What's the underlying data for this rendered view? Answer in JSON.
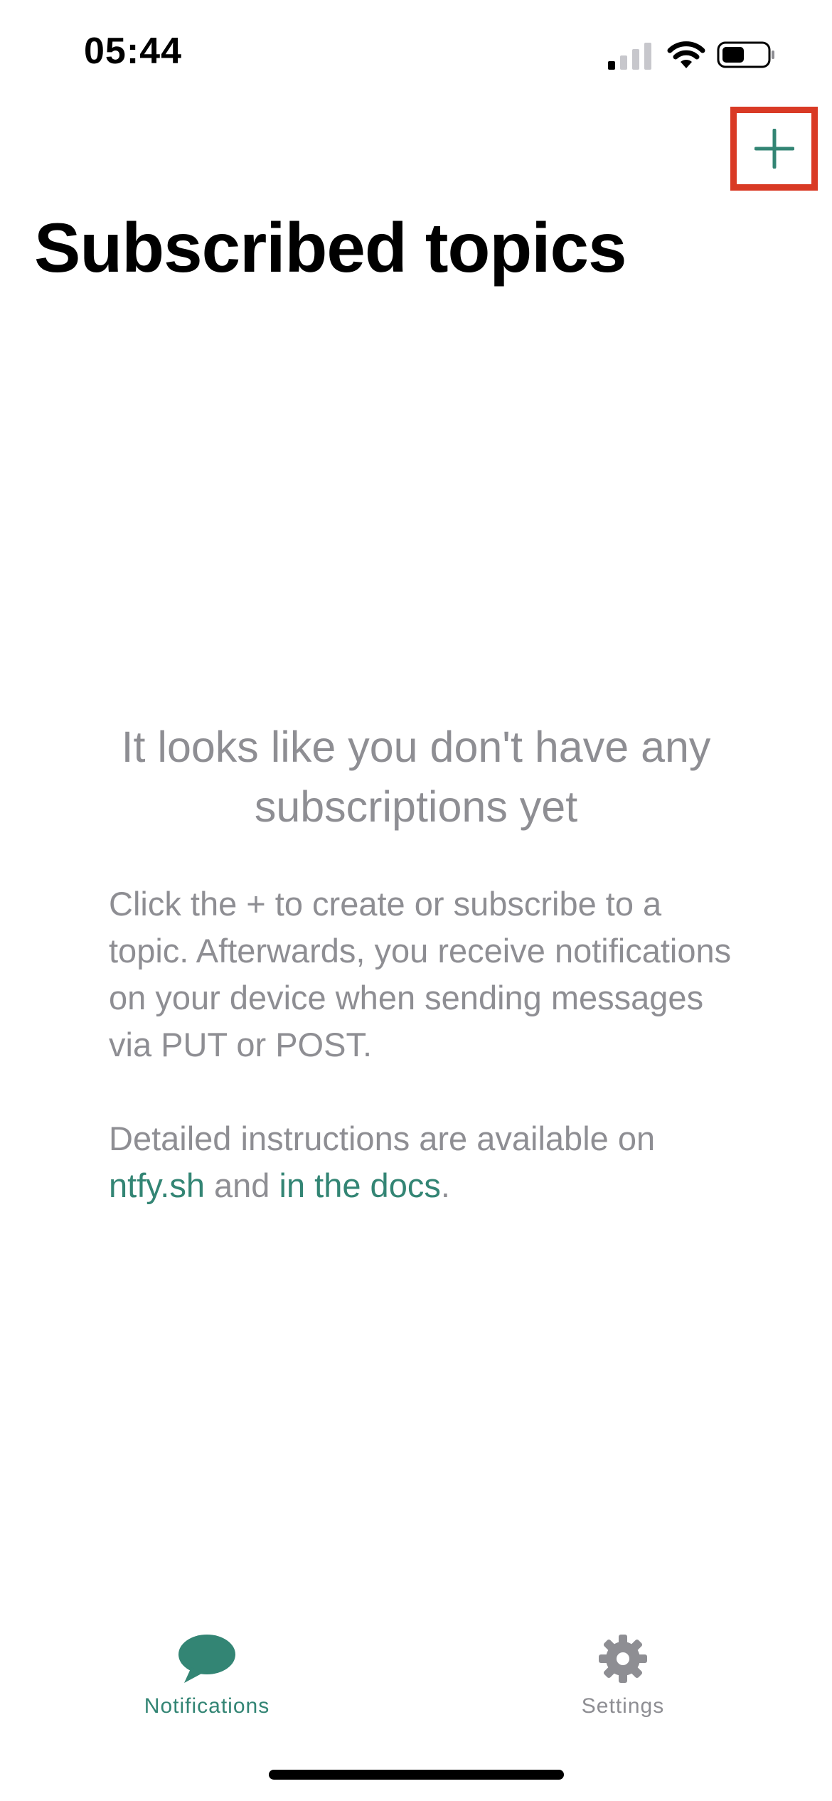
{
  "status_bar": {
    "time": "05:44",
    "icons": [
      "cellular-signal-icon",
      "wifi-icon",
      "battery-icon"
    ]
  },
  "header": {
    "add_icon": "plus-icon",
    "title": "Subscribed topics"
  },
  "empty_state": {
    "heading": "It looks like you don't have any subscriptions yet",
    "body": "Click the + to create or subscribe to a topic. Afterwards, you receive notifications on your device when sending messages via PUT or POST.",
    "details_prefix": "Detailed instructions are available on ",
    "link_site": "ntfy.sh",
    "details_middle": " and ",
    "link_docs": "in the docs",
    "details_suffix": "."
  },
  "tab_bar": {
    "notifications": {
      "label": "Notifications",
      "icon": "chat-bubble-icon",
      "active": true
    },
    "settings": {
      "label": "Settings",
      "icon": "gear-icon",
      "active": false
    }
  },
  "colors": {
    "accent": "#338574",
    "secondary_text": "#8e8e93",
    "highlight_border": "#d93a25"
  }
}
